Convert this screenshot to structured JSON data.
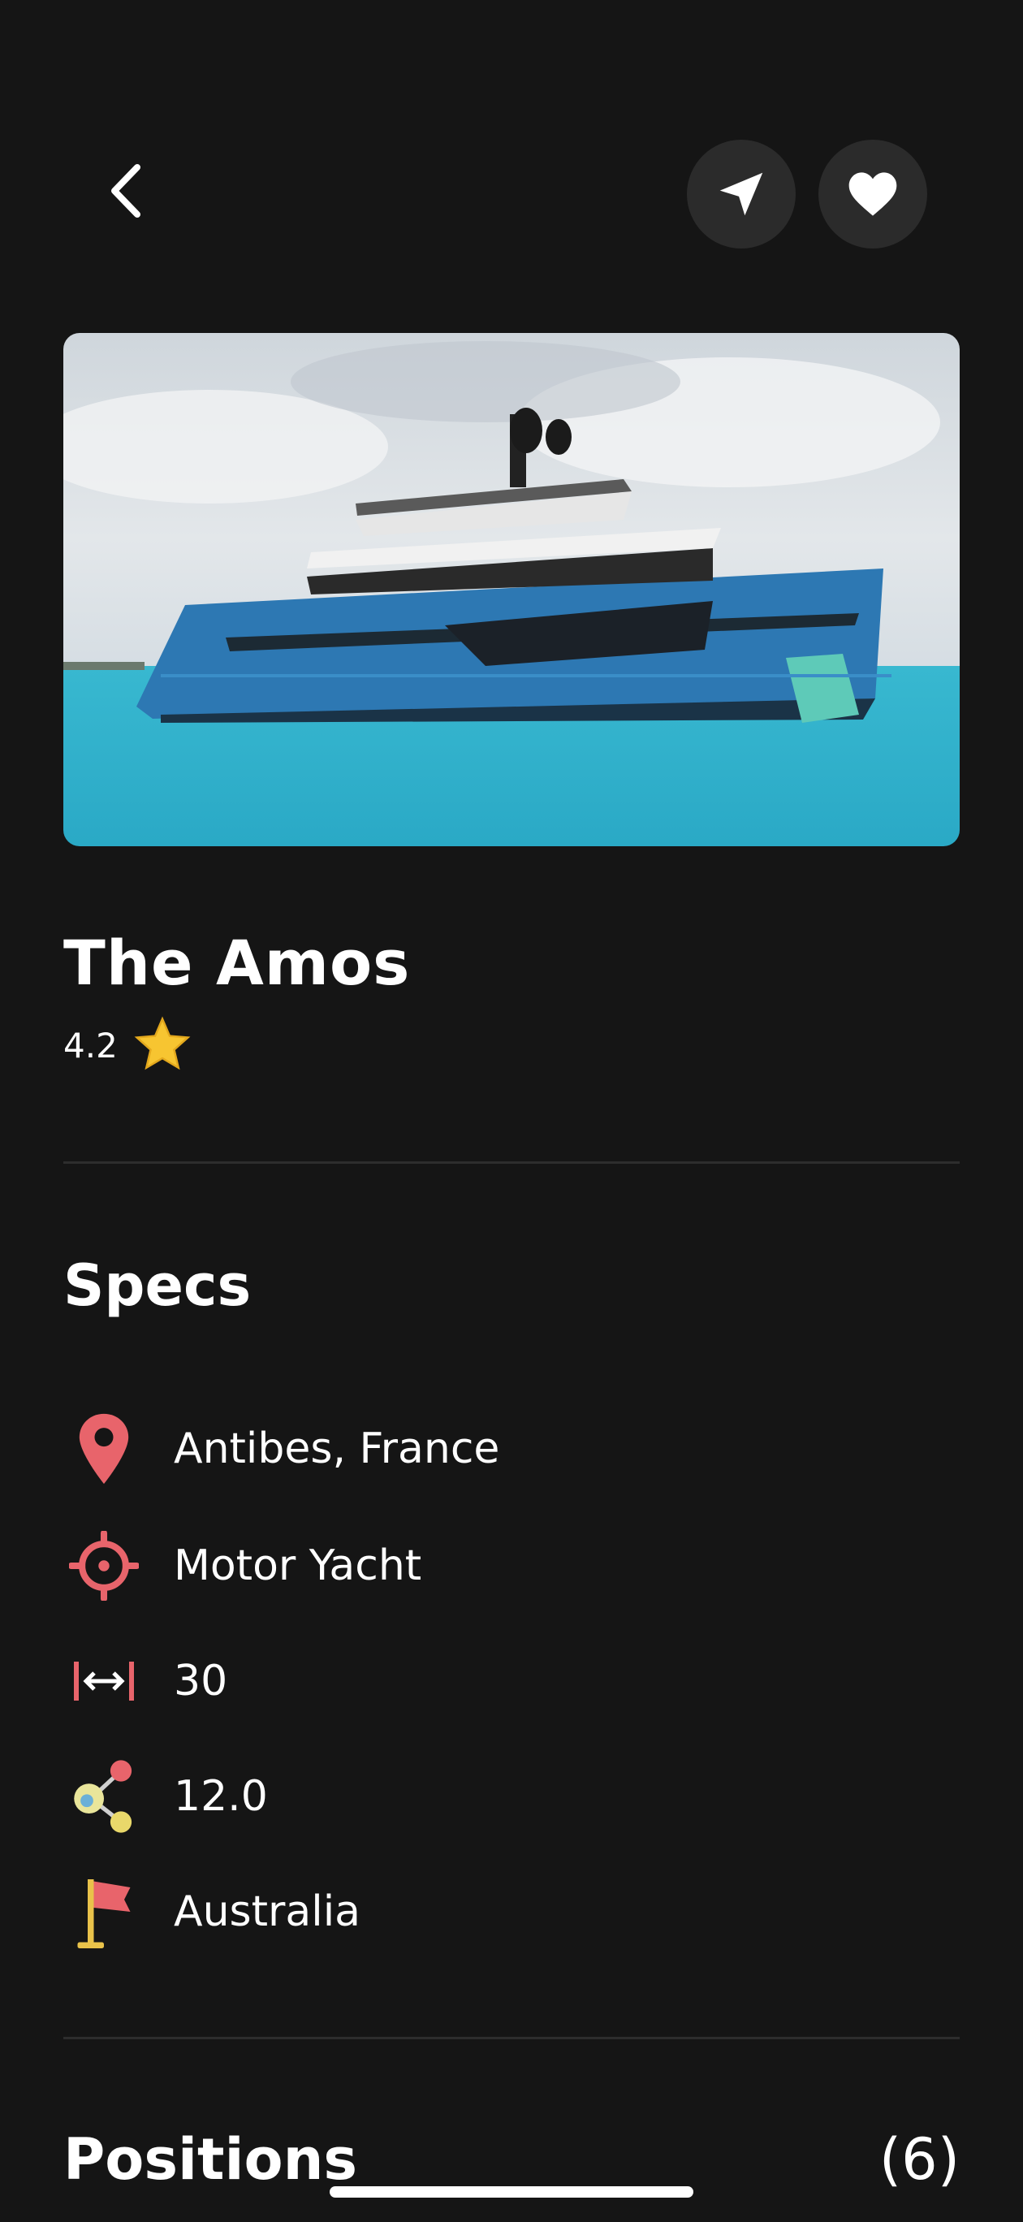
{
  "header": {
    "back_icon": "chevron-left-icon",
    "share_icon": "send-icon",
    "favorite_icon": "heart-icon"
  },
  "yacht": {
    "name": "The Amos",
    "rating": "4.2",
    "rating_icon": "star-icon"
  },
  "specs": {
    "title": "Specs",
    "items": [
      {
        "icon": "location-pin-icon",
        "label": "Antibes, France"
      },
      {
        "icon": "target-icon",
        "label": "Motor Yacht"
      },
      {
        "icon": "length-icon",
        "label": "30"
      },
      {
        "icon": "network-icon",
        "label": "12.0"
      },
      {
        "icon": "flag-icon",
        "label": "Australia"
      }
    ]
  },
  "positions": {
    "title": "Positions",
    "count": "(6)"
  },
  "colors": {
    "background": "#151515",
    "accent": "#e8646b",
    "star": "#f7c531"
  }
}
